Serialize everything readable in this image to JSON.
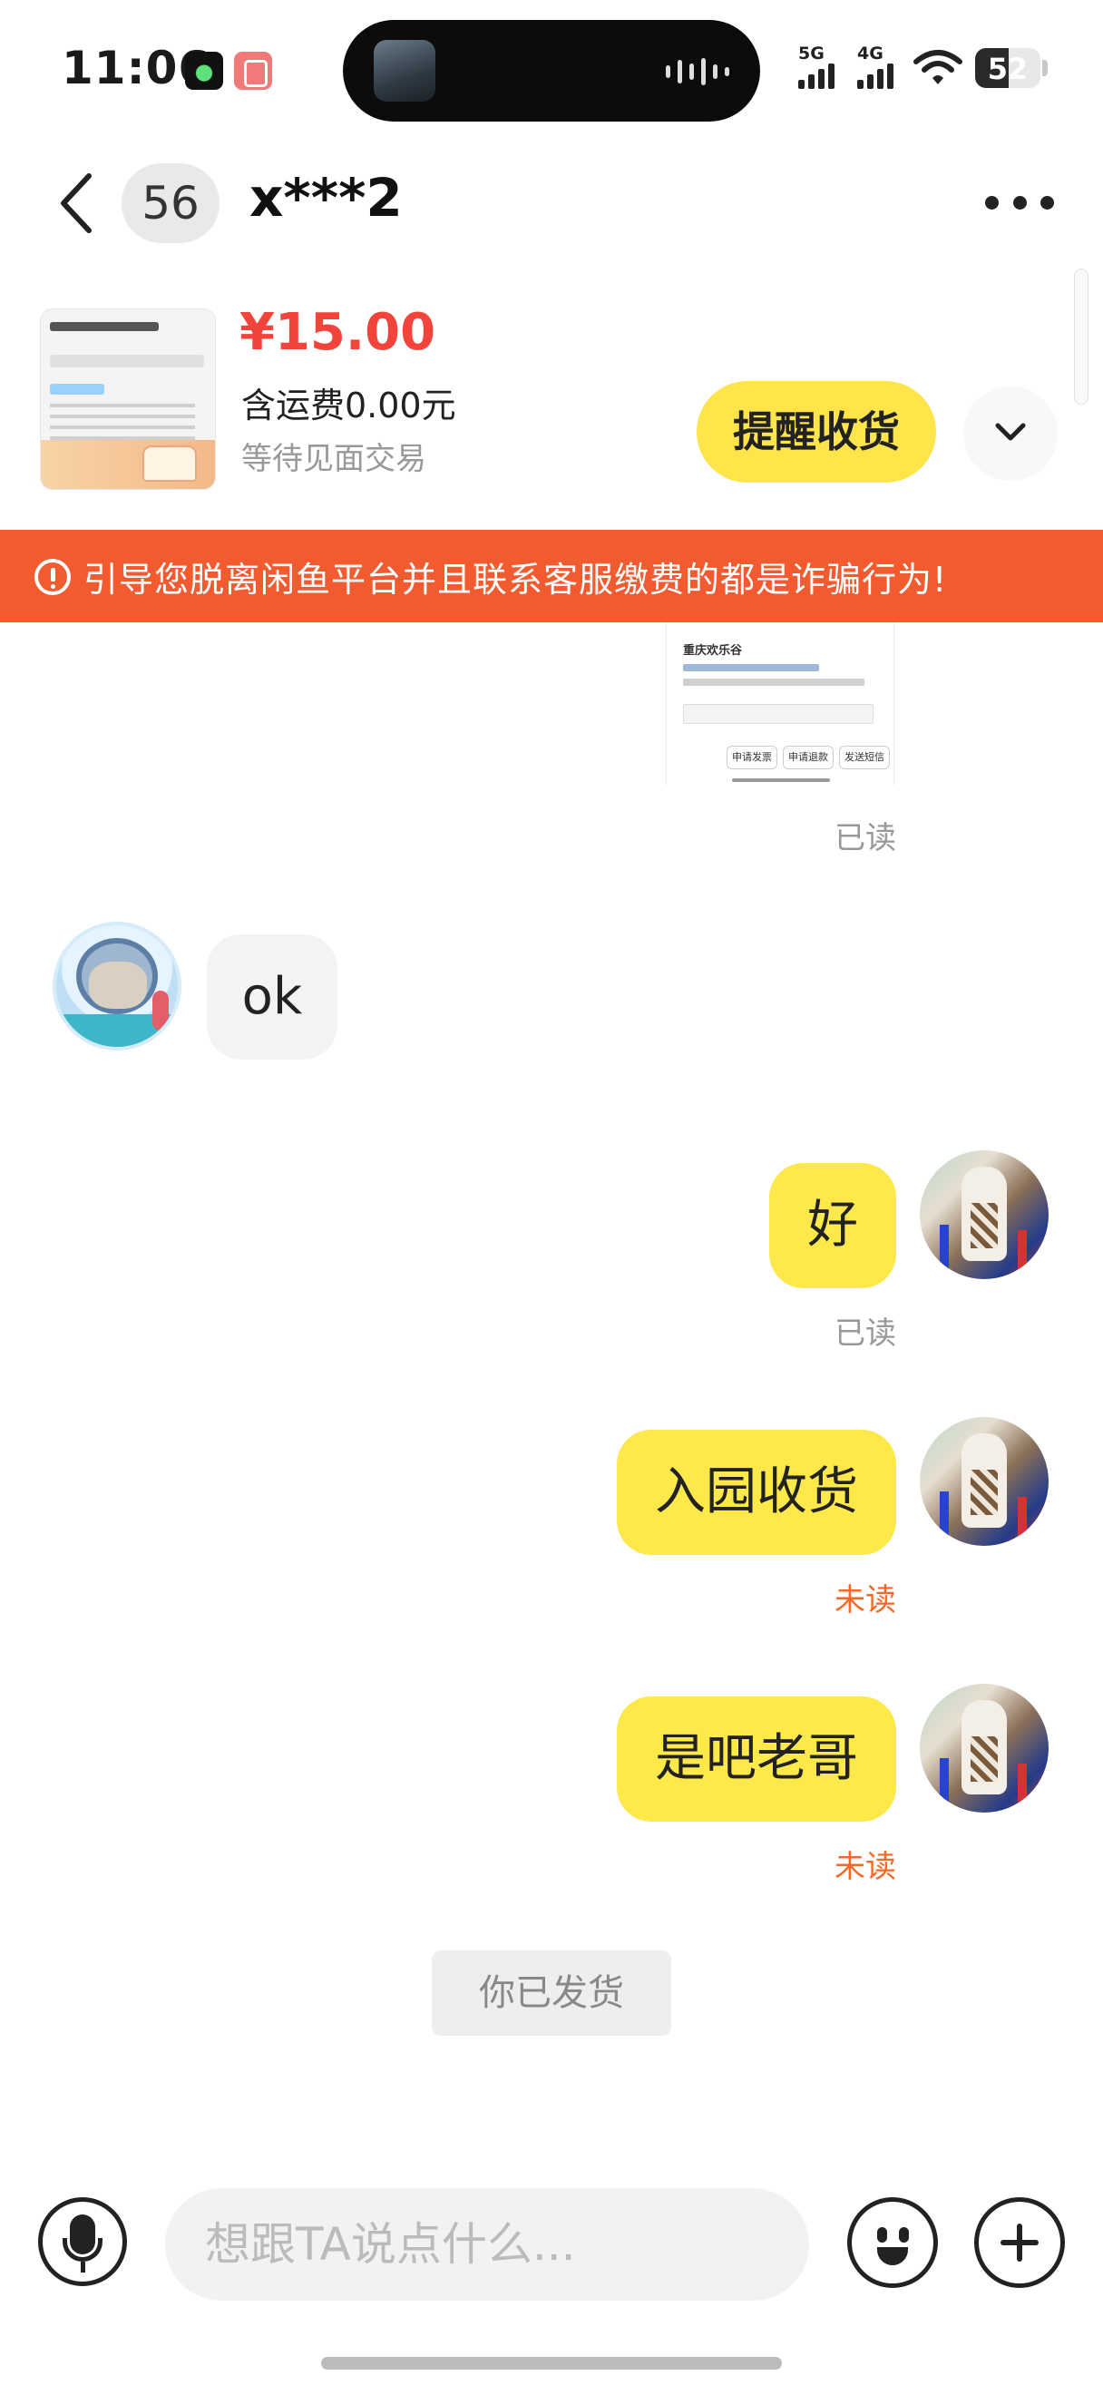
{
  "status_bar": {
    "time": "11:06",
    "signal_1": "5G",
    "signal_2": "4G",
    "battery": "52"
  },
  "header": {
    "unread_count": "56",
    "title": "x***2"
  },
  "product": {
    "price": "¥15.00",
    "shipping": "含运费0.00元",
    "status": "等待见面交易",
    "remind_button": "提醒收货"
  },
  "banner": {
    "text": "引导您脱离闲鱼平台并且联系客服缴费的都是诈骗行为!"
  },
  "screenshot_message": {
    "place_name": "重庆欢乐谷",
    "buttons": [
      "申请发票",
      "申请退款",
      "发送短信"
    ],
    "status": "已读"
  },
  "messages": [
    {
      "side": "in",
      "text": "ok"
    },
    {
      "side": "out",
      "text": "好",
      "status": "已读"
    },
    {
      "side": "out",
      "text": "入园收货",
      "status": "未读"
    },
    {
      "side": "out",
      "text": "是吧老哥",
      "status": "未读"
    }
  ],
  "system_notice": "你已发货",
  "composer": {
    "placeholder": "想跟TA说点什么..."
  },
  "colors": {
    "accent_yellow": "#ffe84a",
    "price_red": "#f2443b",
    "banner_orange": "#f25a2f",
    "unread_orange": "#f26a2a"
  }
}
